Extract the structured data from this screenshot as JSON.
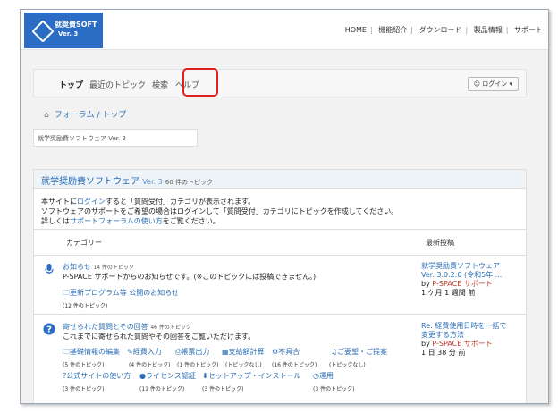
{
  "header": {
    "logo_name": "就奨費SOFT",
    "logo_version": "Ver. 3",
    "nav": [
      "HOME",
      "機能紹介",
      "ダウンロード",
      "製品情報",
      "サポート"
    ]
  },
  "forum_nav": {
    "items": [
      "トップ",
      "最近のトピック",
      "検索",
      "ヘルプ"
    ],
    "login_label": "ログイン ▾"
  },
  "breadcrumb": {
    "text": "フォーラム / トップ"
  },
  "search": {
    "value": "就学奨励費ソフトウェア Ver. 3"
  },
  "card": {
    "title": "就学奨励費ソフトウェア",
    "version": "Ver. 3",
    "count": "60 件のトピック",
    "intro_line1_pre": "本サイトに",
    "intro_line1_link": "ログイン",
    "intro_line1_post": "すると「質問受付」カテゴリが表示されます。",
    "intro_line2": "ソフトウェアのサポートをご希望の場合はログインして「質問受付」カテゴリにトピックを作成してください。",
    "intro_line3_pre": "詳しくは",
    "intro_line3_link": "サポートフォーラムの使い方",
    "intro_line3_post": "をご覧ください。",
    "col_category": "カテゴリー",
    "col_latest": "最新投稿"
  },
  "categories": [
    {
      "title": "お知らせ",
      "count": "14 件のトピック",
      "desc": "P-SPACE サポートからのお知らせです。(※このトピックには投稿できません。)",
      "sub": "更新プログラム等 公開のお知らせ",
      "sub_count": "(12 件のトピック)",
      "latest_title": "就学奨励費ソフトウェア",
      "latest_title2": "Ver. 3.0.2.0 (令和5年 ...",
      "latest_by": "by",
      "latest_author": "P-SPACE サポート",
      "latest_time": "1 ケ月 1 週間 前"
    },
    {
      "title": "寄せられた質問とその回答",
      "count": "46 件のトピック",
      "desc": "これまでに寄せられた質問やその回答をご覧いただけます。",
      "subs_row1": [
        "基礎情報の編集",
        "経費入力",
        "帳票出力",
        "支給額計算",
        "不具合",
        "ご要望・ご提案"
      ],
      "counts_row1": [
        "(5 件のトピック)",
        "(4 件のトピック)",
        "(1 件のトピック)",
        "(トピックなし)",
        "(16 件のトピック)",
        "(トピックなし)"
      ],
      "subs_row2": [
        "公式サイトの使い方",
        "ライセンス認証",
        "セットアップ・インストール",
        "運用"
      ],
      "counts_row2": [
        "(3 件のトピック)",
        "(11 件のトピック)",
        "(3 件のトピック)",
        "(3 件のトピック)"
      ],
      "latest_title": "Re: 経費使用日時を一括で",
      "latest_title2": "変更する方法",
      "latest_by": "by",
      "latest_author": "P-SPACE サポート",
      "latest_time": "1 日 38 分 前"
    }
  ],
  "colors": {
    "brand": "#2b6dc4",
    "link": "#2a6db5",
    "highlight": "#e02020"
  }
}
